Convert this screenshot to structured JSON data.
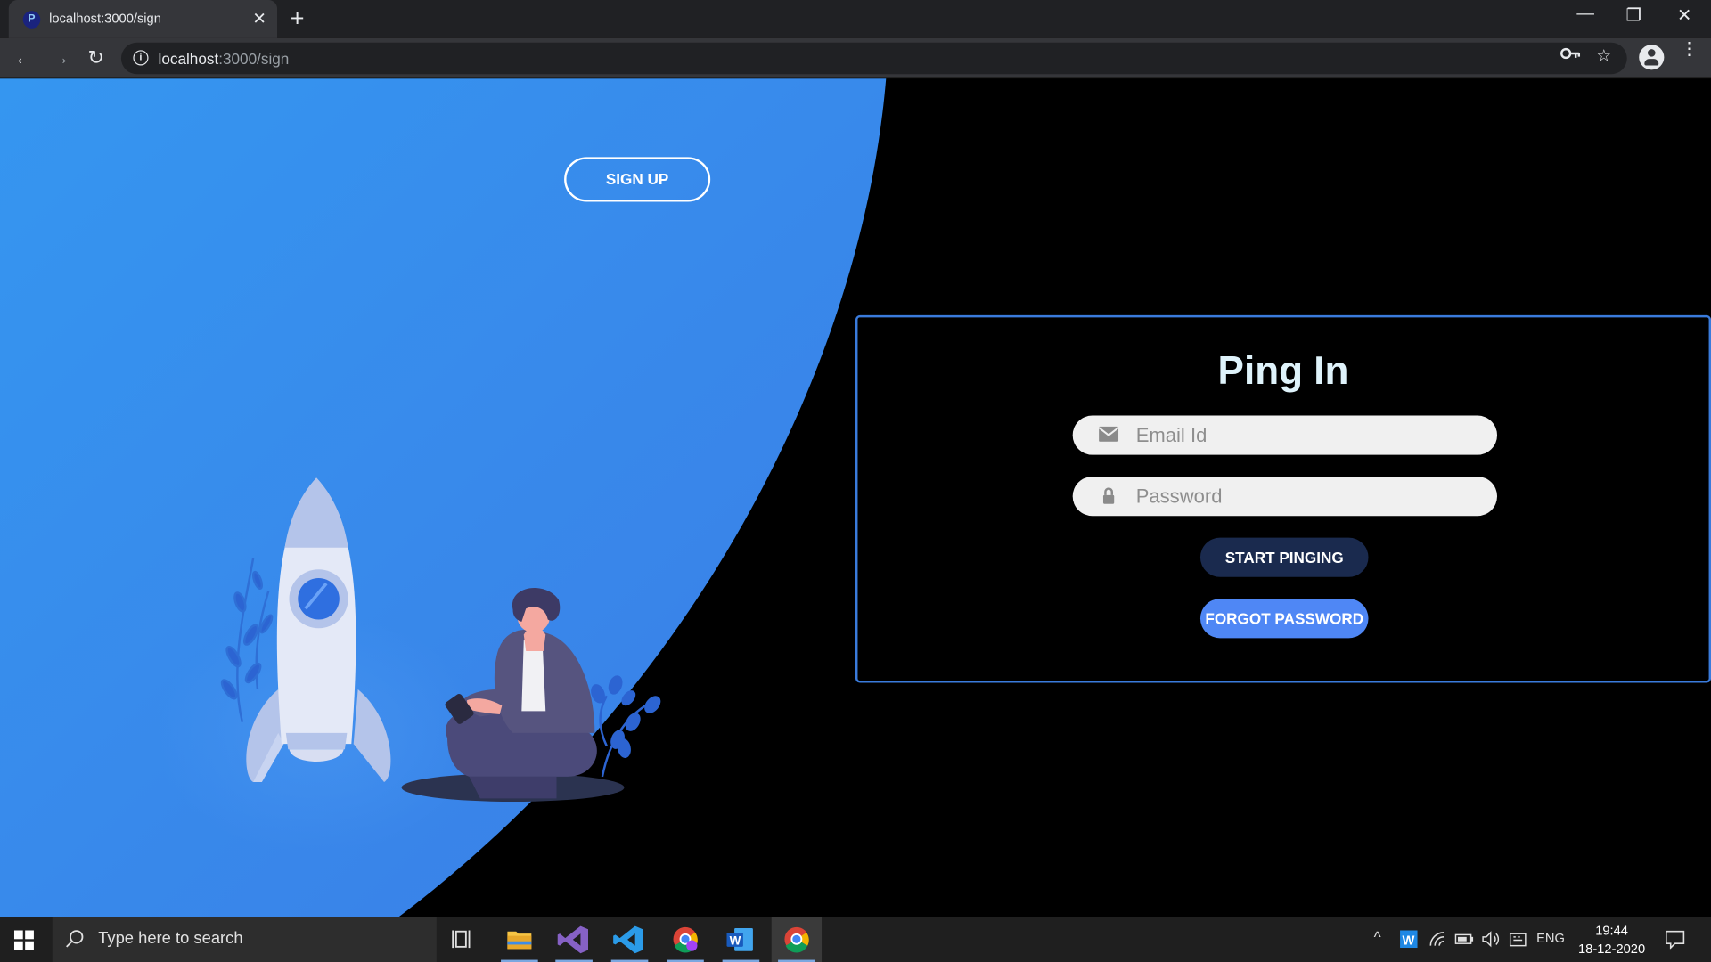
{
  "browser": {
    "tab_title": "localhost:3000/sign",
    "favicon_letter": "P",
    "url_host": "localhost",
    "url_path": ":3000/sign"
  },
  "page": {
    "signup_label": "SIGN UP",
    "login_title": "Ping In",
    "email_placeholder": "Email Id",
    "password_placeholder": "Password",
    "start_label": "START PINGING",
    "forgot_label": "FORGOT PASSWORD",
    "colors": {
      "hero_blue": "#3a86ea",
      "card_border": "#3a7bdc",
      "start_button": "#1a2a4e",
      "forgot_button": "#4f87f5"
    }
  },
  "taskbar": {
    "search_placeholder": "Type here to search",
    "apps": [
      "task-view",
      "file-explorer",
      "visual-studio",
      "vs-code",
      "chrome-profile",
      "word",
      "chrome"
    ],
    "language": "ENG",
    "time": "19:44",
    "date": "18-12-2020"
  }
}
